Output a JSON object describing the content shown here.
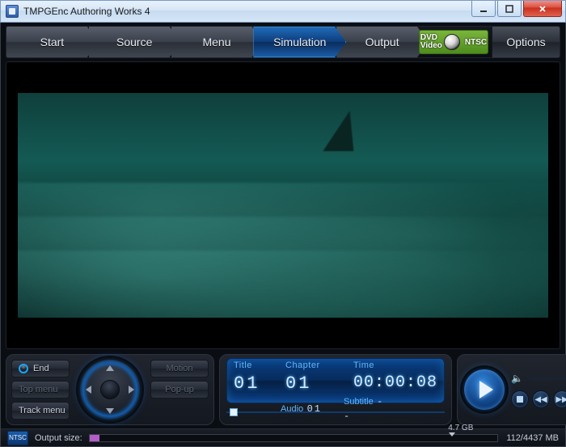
{
  "titlebar": {
    "title": "TMPGEnc Authoring Works 4"
  },
  "nav": {
    "steps": [
      "Start",
      "Source",
      "Menu",
      "Simulation",
      "Output"
    ],
    "selected_idx": 3,
    "badge": {
      "line1": "DVD",
      "line2": "Video",
      "std": "NTSC"
    },
    "options": "Options"
  },
  "menu_buttons": {
    "end": "End",
    "top_menu": "Top menu",
    "track_menu": "Track menu",
    "motion": "Motion",
    "popup": "Pop-up"
  },
  "info": {
    "title_label": "Title",
    "title_value": "01",
    "chapter_label": "Chapter",
    "chapter_value": "01",
    "time_label": "Time",
    "time_value": "00:00:08",
    "audio_label": "Audio",
    "audio_value": "01",
    "subtitle_label": "Subtitle",
    "subtitle_value": "--"
  },
  "status": {
    "disc_std": "NTSC",
    "output_label": "Output size:",
    "capacity_label": "4.7 GB",
    "memory": "112/4437 MB"
  }
}
